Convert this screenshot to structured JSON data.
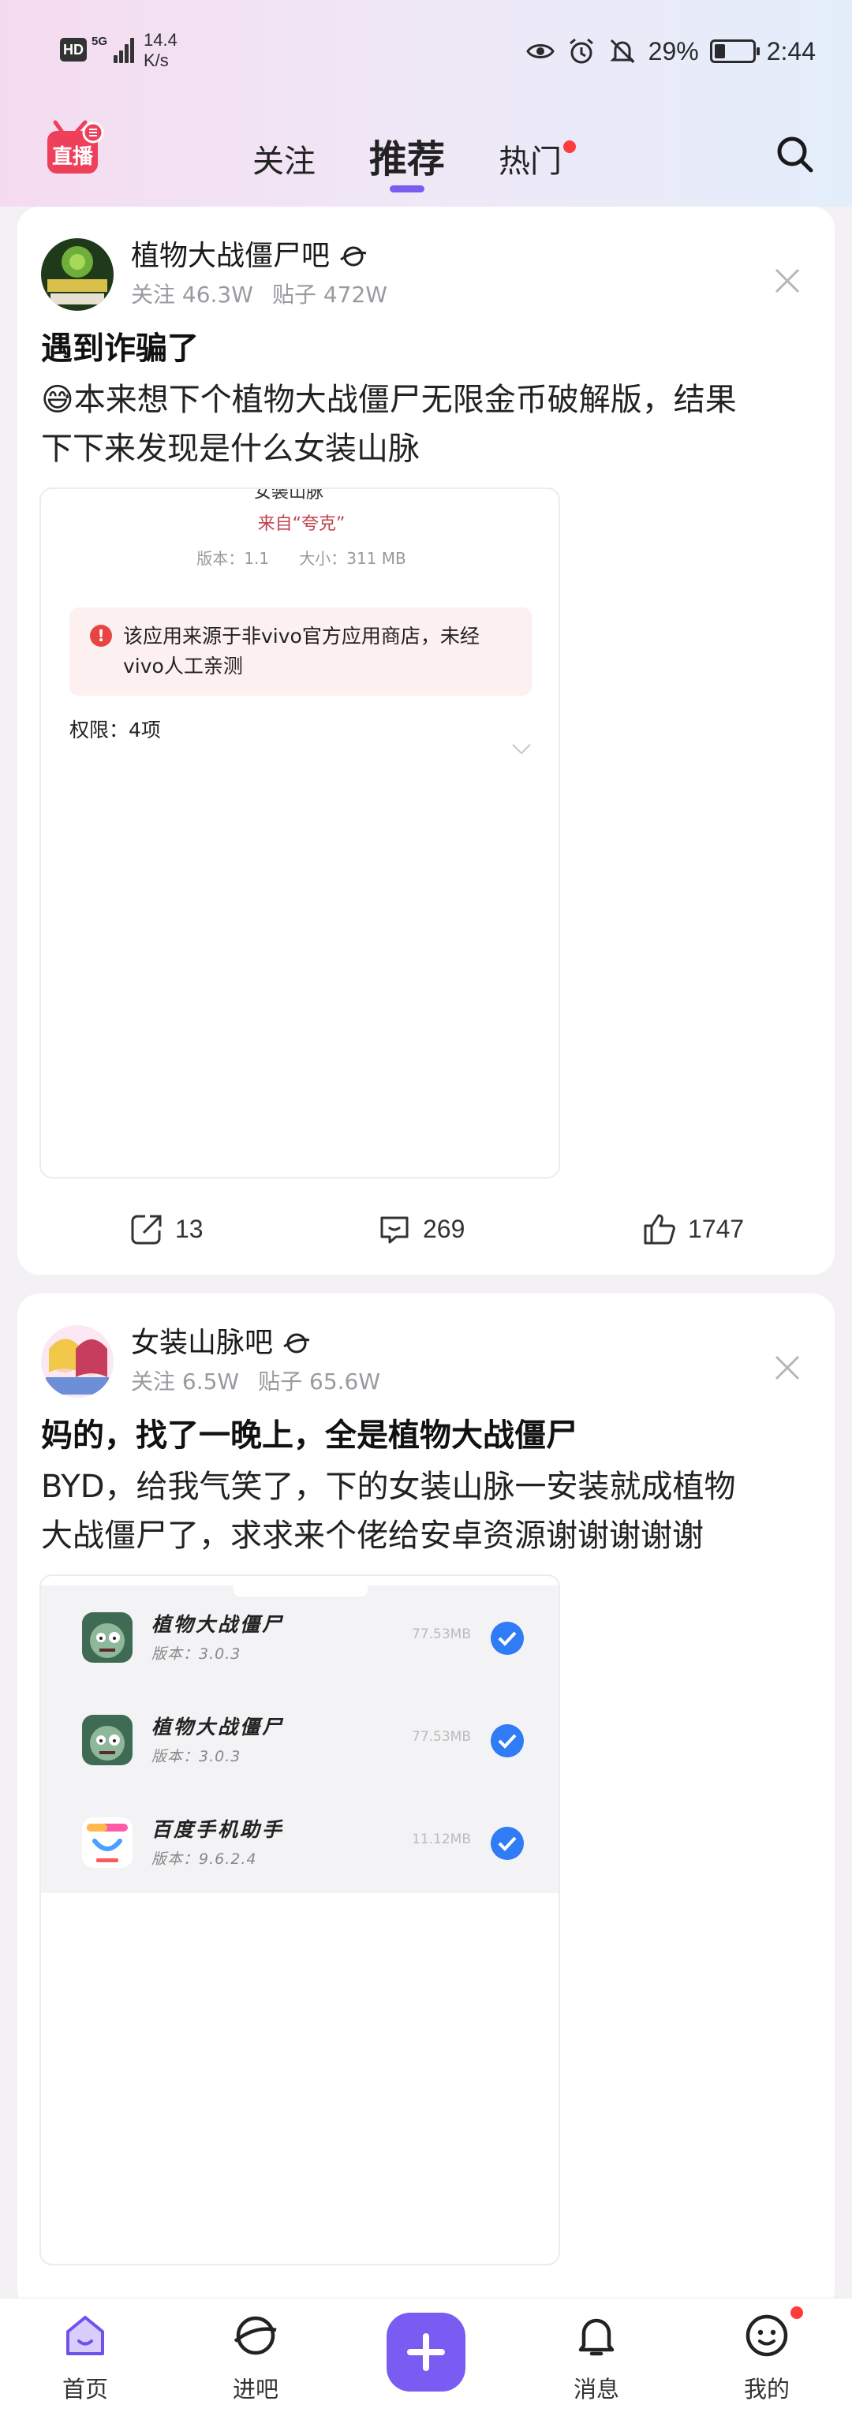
{
  "status_bar": {
    "hd": "HD",
    "network": "5G",
    "speed_value": "14.4",
    "speed_unit": "K/s",
    "battery_percent": "29%",
    "battery_level": 0.29,
    "time": "2:44"
  },
  "top_nav": {
    "logo_text": "直播",
    "tabs": [
      {
        "label": "关注"
      },
      {
        "label": "推荐"
      },
      {
        "label": "热门"
      }
    ],
    "active_tab": "推荐"
  },
  "posts": [
    {
      "forum": "植物大战僵尸吧",
      "follow": "关注 46.3W",
      "posts_count": "贴子 472W",
      "title": "遇到诈骗了",
      "body_line1": "😅本来想下个植物大战僵尸无限金币破解版，结果",
      "body_line2": "下下来发现是什么女装山脉",
      "screenshot": {
        "cut_text": "女装山脉",
        "source": "来自“夸克”",
        "version": "版本：1.1",
        "size": "大小：311 MB",
        "warning": "该应用来源于非vivo官方应用商店，未经vivo人工亲测",
        "permissions": "权限：4项"
      },
      "shares": "13",
      "comments": "269",
      "likes": "1747"
    },
    {
      "forum": "女装山脉吧",
      "follow": "关注 6.5W",
      "posts_count": "贴子 65.6W",
      "title": "妈的，找了一晚上，全是植物大战僵尸",
      "body_line1": "BYD，给我气笑了，下的女装山脉一安装就成植物",
      "body_line2": "大战僵尸了，求求来个佬给安卓资源谢谢谢谢谢",
      "apps": [
        {
          "name": "植物大战僵尸",
          "version": "版本：3.0.3",
          "size": "77.53MB",
          "icon": "zombie-icon"
        },
        {
          "name": "植物大战僵尸",
          "version": "版本：3.0.3",
          "size": "77.53MB",
          "icon": "zombie-icon"
        },
        {
          "name": "百度手机助手",
          "version": "版本：9.6.2.4",
          "size": "11.12MB",
          "icon": "baidu-assistant-icon"
        }
      ]
    }
  ],
  "bottom_nav": {
    "items": [
      {
        "label": "首页",
        "icon": "home-icon"
      },
      {
        "label": "进吧",
        "icon": "planet-icon"
      },
      {
        "label": "",
        "icon": "plus-icon"
      },
      {
        "label": "消息",
        "icon": "bell-icon"
      },
      {
        "label": "我的",
        "icon": "smiley-icon"
      }
    ]
  },
  "colors": {
    "accent": "#7b5cf0",
    "badge_red": "#ff3b3b",
    "check_blue": "#2f7cf6",
    "warn_red": "#e94444"
  }
}
